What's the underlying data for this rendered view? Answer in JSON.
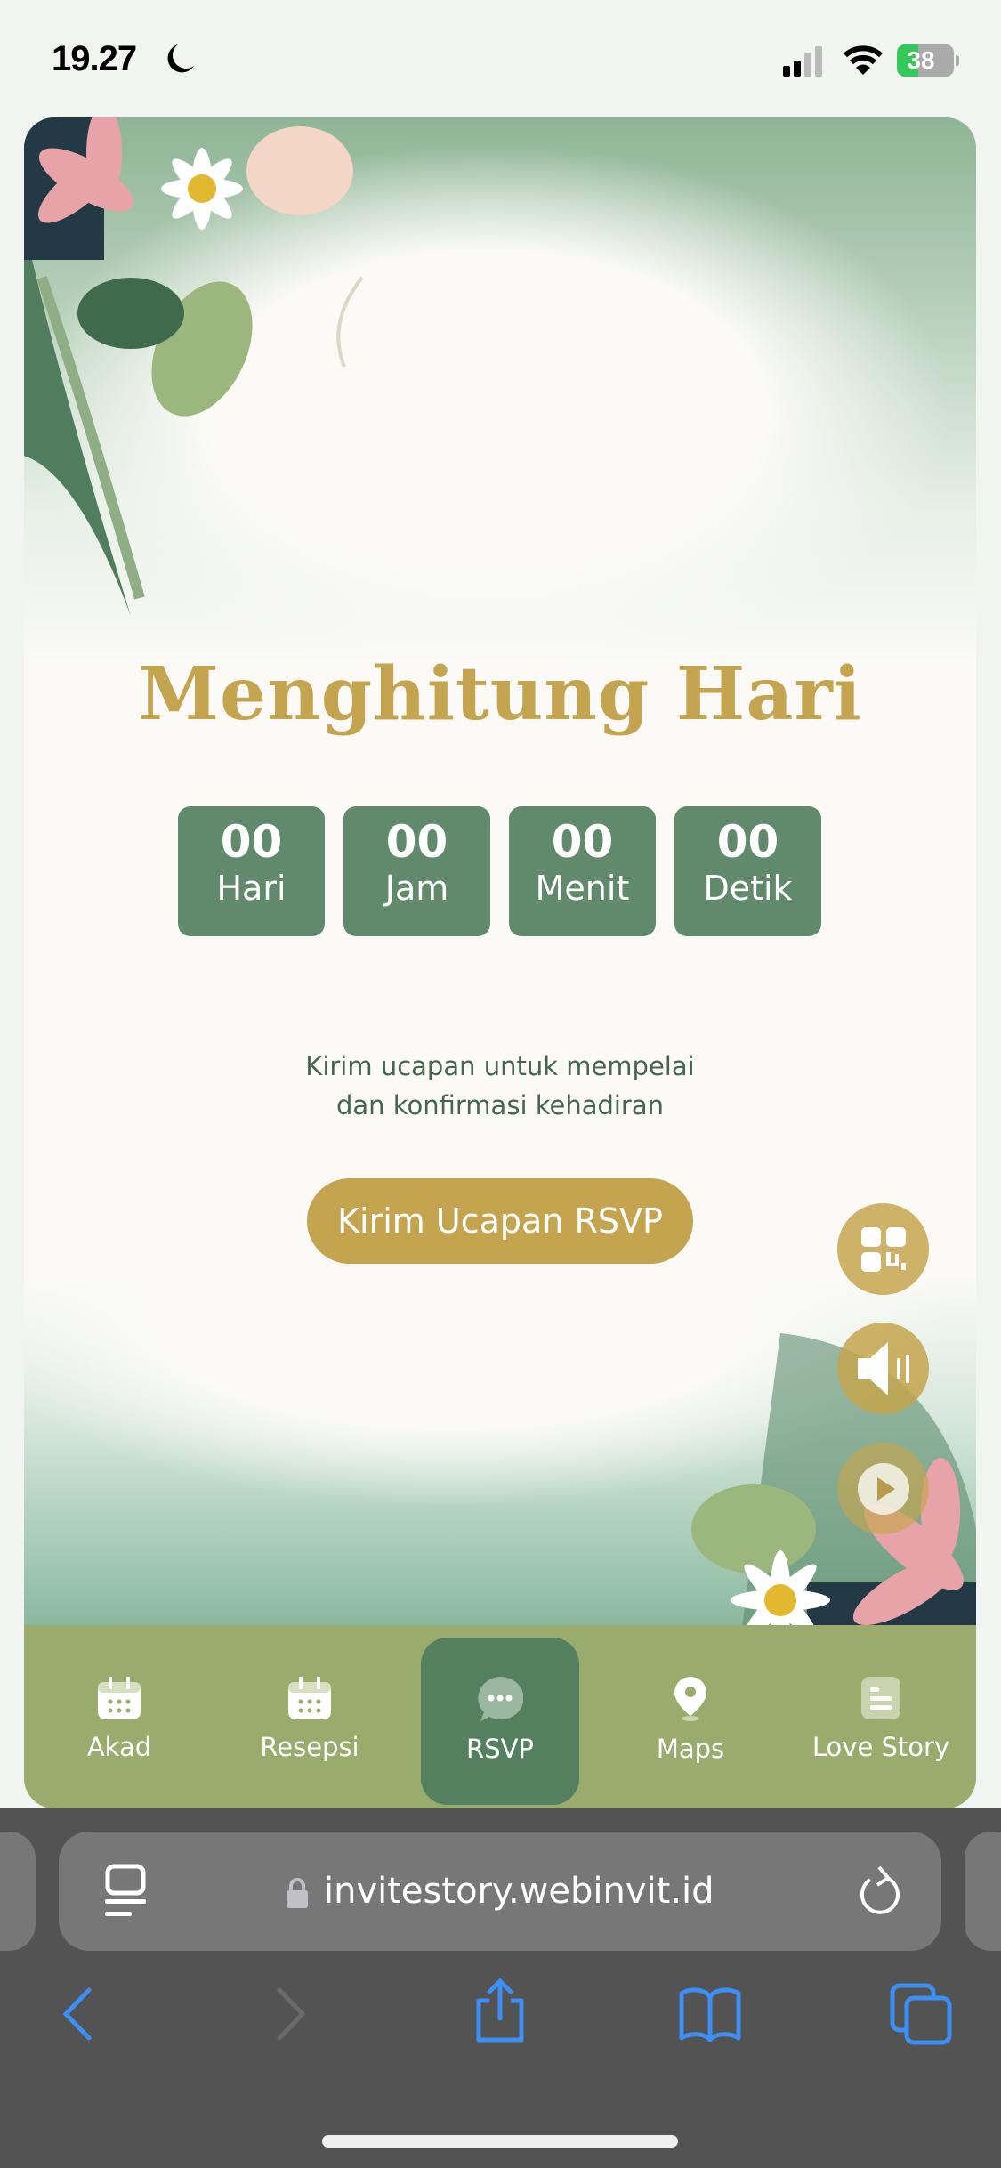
{
  "status_bar": {
    "time": "19.27",
    "battery": "38",
    "icons": [
      "moon-icon",
      "signal-icon",
      "wifi-icon",
      "battery-charging-icon"
    ]
  },
  "countdown": {
    "title": "Menghitung Hari",
    "units": [
      {
        "value": "00",
        "label": "Hari"
      },
      {
        "value": "00",
        "label": "Jam"
      },
      {
        "value": "00",
        "label": "Menit"
      },
      {
        "value": "00",
        "label": "Detik"
      }
    ]
  },
  "rsvp": {
    "line1": "Kirim ucapan untuk mempelai",
    "line2": "dan konfirmasi kehadiran",
    "button_label": "Kirim Ucapan RSVP"
  },
  "floating_buttons": [
    "qr-code-icon",
    "speaker-icon",
    "play-icon"
  ],
  "bottom_nav": {
    "active": "RSVP",
    "items": [
      {
        "label": "Akad",
        "icon": "calendar-icon"
      },
      {
        "label": "Resepsi",
        "icon": "calendar-icon"
      },
      {
        "label": "RSVP",
        "icon": "chat-bubble-icon"
      },
      {
        "label": "Maps",
        "icon": "map-pin-icon"
      },
      {
        "label": "Love Story",
        "icon": "document-icon"
      }
    ]
  },
  "browser": {
    "url": "invitestory.webinvit.id"
  },
  "colors": {
    "gold": "#c4a44e",
    "green": "#61896b",
    "nav_bg": "#9aab6e",
    "nav_active": "#55805f",
    "safari_blue": "#3d8ef5"
  }
}
